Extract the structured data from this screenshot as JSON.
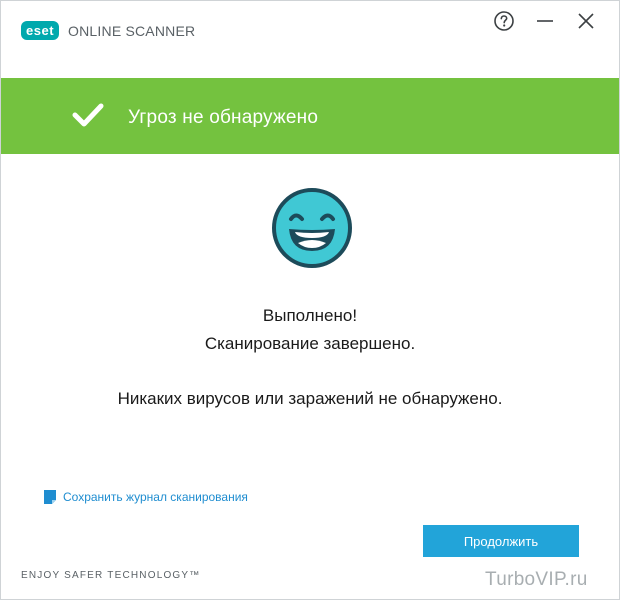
{
  "app": {
    "logo_text": "eset",
    "product": "ONLINE SCANNER"
  },
  "titlebar": {
    "help_icon": "question-circle-icon",
    "minimize_icon": "minimize-icon",
    "close_icon": "close-icon"
  },
  "banner": {
    "icon": "checkmark-icon",
    "text": "Угроз не обнаружено",
    "color": "#74c23f"
  },
  "result": {
    "icon": "smiley-face-icon",
    "line1": "Выполнено!",
    "line2": "Сканирование завершено.",
    "line3": "Никаких вирусов или заражений не обнаружено."
  },
  "save_log": {
    "icon": "document-icon",
    "label": "Сохранить журнал сканирования"
  },
  "continue_button": {
    "label": "Продолжить",
    "color": "#22a4d9"
  },
  "footer": {
    "tagline": "ENJOY SAFER TECHNOLOGY™"
  },
  "watermark": "TurboVIP.ru"
}
